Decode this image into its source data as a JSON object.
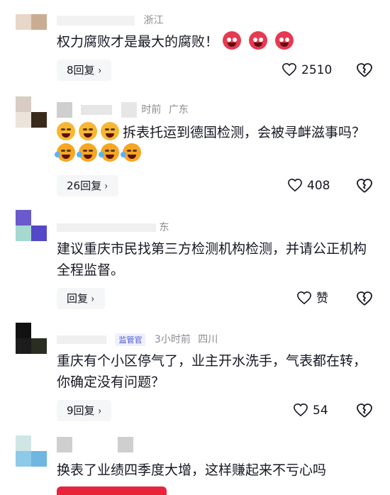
{
  "comments": [
    {
      "location": "浙江",
      "time": "",
      "text": "权力腐败才是最大的腐败！",
      "emojis": [
        "angry",
        "angry",
        "angry"
      ],
      "replies": "8回复",
      "likes": "2510"
    },
    {
      "location": "广东",
      "time": "时前",
      "text": "拆表托运到德国检测，会被寻衅滋事吗？",
      "emojis_before": [
        "laugh",
        "laugh",
        "laugh"
      ],
      "emojis_after": [
        "cry",
        "cry",
        "cry",
        "cry"
      ],
      "replies": "26回复",
      "likes": "408"
    },
    {
      "location": "东",
      "text": "建议重庆市民找第三方检测机构检测，并请公正机构全程监督。",
      "replies": "回复",
      "likes": "赞"
    },
    {
      "badge": "监管官",
      "time": "3小时前",
      "location": "四川",
      "text": "重庆有个小区停气了，业主开水洗手，气表都在转，你确定没有问题？",
      "replies": "9回复",
      "likes": "54"
    },
    {
      "text": "换表了业绩四季度大增，这样赚起来不亏心吗"
    }
  ],
  "colors": {
    "text": "#161823",
    "meta": "#8a8b91",
    "reply_bg": "#f5f6f7",
    "accent_red": "#e8243a"
  },
  "icons": {
    "like": "heart-outline-icon",
    "dislike": "broken-heart-icon",
    "chevron": "chevron-right-icon"
  }
}
